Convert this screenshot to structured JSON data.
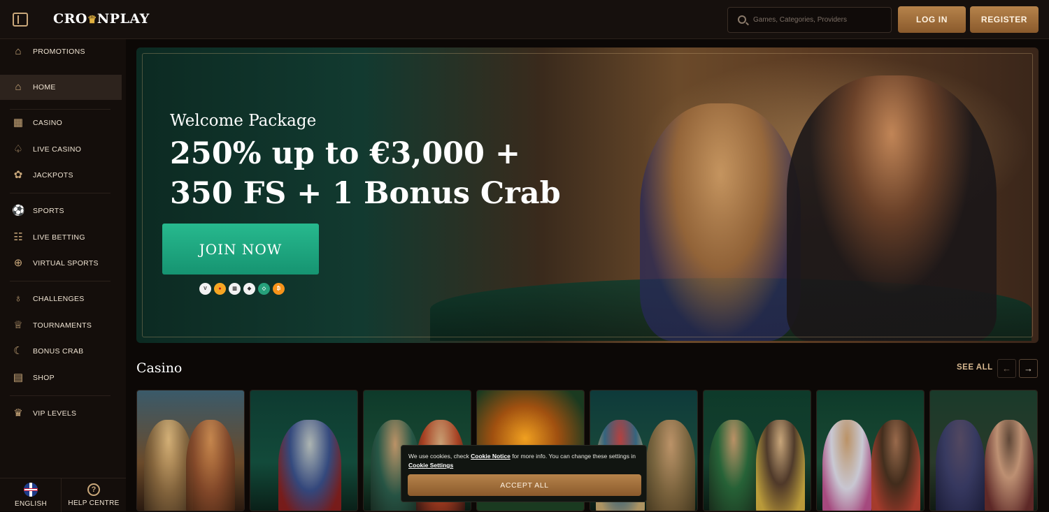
{
  "header": {
    "logo_text_left": "CRO",
    "logo_crown_icon": "crown-icon",
    "logo_text_right": "NPLAY",
    "search_placeholder": "Games, Categories, Providers",
    "login_label": "LOG IN",
    "register_label": "REGISTER"
  },
  "sidebar": {
    "items": [
      {
        "label": "PROMOTIONS",
        "icon": "gift-icon"
      },
      {
        "label": "HOME",
        "icon": "home-icon"
      },
      {
        "label": "CASINO",
        "icon": "slot-machine-icon"
      },
      {
        "label": "LIVE CASINO",
        "icon": "spade-icon"
      },
      {
        "label": "JACKPOTS",
        "icon": "jackpot-icon"
      },
      {
        "label": "SPORTS",
        "icon": "ball-icon"
      },
      {
        "label": "LIVE BETTING",
        "icon": "live-betting-icon"
      },
      {
        "label": "VIRTUAL SPORTS",
        "icon": "gamepad-icon"
      },
      {
        "label": "CHALLENGES",
        "icon": "medal-icon"
      },
      {
        "label": "TOURNAMENTS",
        "icon": "trophy-icon"
      },
      {
        "label": "BONUS CRAB",
        "icon": "crab-icon"
      },
      {
        "label": "SHOP",
        "icon": "shop-icon"
      },
      {
        "label": "VIP LEVELS",
        "icon": "crown-icon"
      }
    ],
    "active": "HOME",
    "footer": {
      "language_label": "ENGLISH",
      "help_label": "HELP CENTRE"
    }
  },
  "hero": {
    "subtitle": "Welcome Package",
    "title_line1": "250% up to €3,000 +",
    "title_line2": "350 FS + 1 Bonus Crab",
    "cta_label": "JOIN NOW",
    "payment_icons": [
      "visa-icon",
      "mastercard-icon",
      "bank-icon",
      "ethereum-icon",
      "tether-icon",
      "bitcoin-icon"
    ]
  },
  "casino_section": {
    "title": "Casino",
    "see_all_label": "SEE ALL",
    "prev_arrow": "←",
    "next_arrow": "→"
  },
  "cookie": {
    "text_1": "We use cookies, check ",
    "link_1": "Cookie Notice",
    "text_2": " for more info. You can change these settings in ",
    "link_2": "Cookie Settings",
    "accept_label": "ACCEPT ALL"
  },
  "colors": {
    "accent_gold": "#b6834b",
    "cta_green": "#27b98e",
    "background": "#0c0806"
  }
}
